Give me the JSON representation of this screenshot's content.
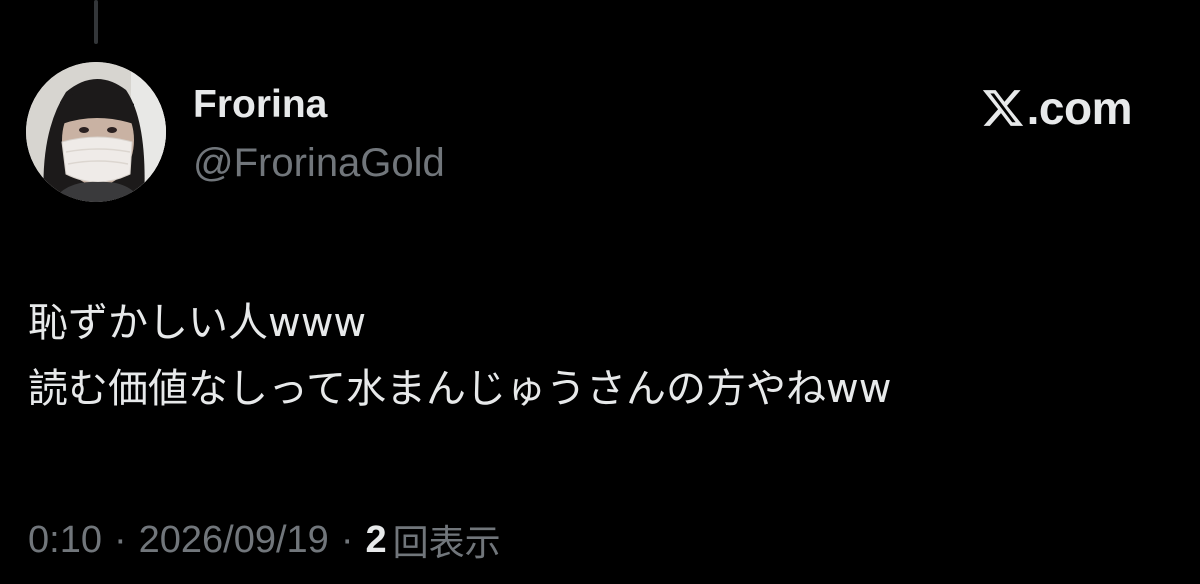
{
  "author": {
    "display_name": "Frorina",
    "handle": "@FrorinaGold"
  },
  "brand": {
    "icon": "x-logo-icon",
    "text": ".com"
  },
  "tweet": {
    "lines": [
      "恥ずかしい人www",
      "読む価値なしって水まんじゅうさんの方やねww"
    ]
  },
  "meta": {
    "time": "0:10",
    "separator": "·",
    "date": "2026/09/19",
    "views_count": "2",
    "views_label": "回表示"
  },
  "colors": {
    "background": "#000000",
    "primary_text": "#e7e9ea",
    "secondary_text": "#71767b",
    "thread_line": "#333639"
  }
}
